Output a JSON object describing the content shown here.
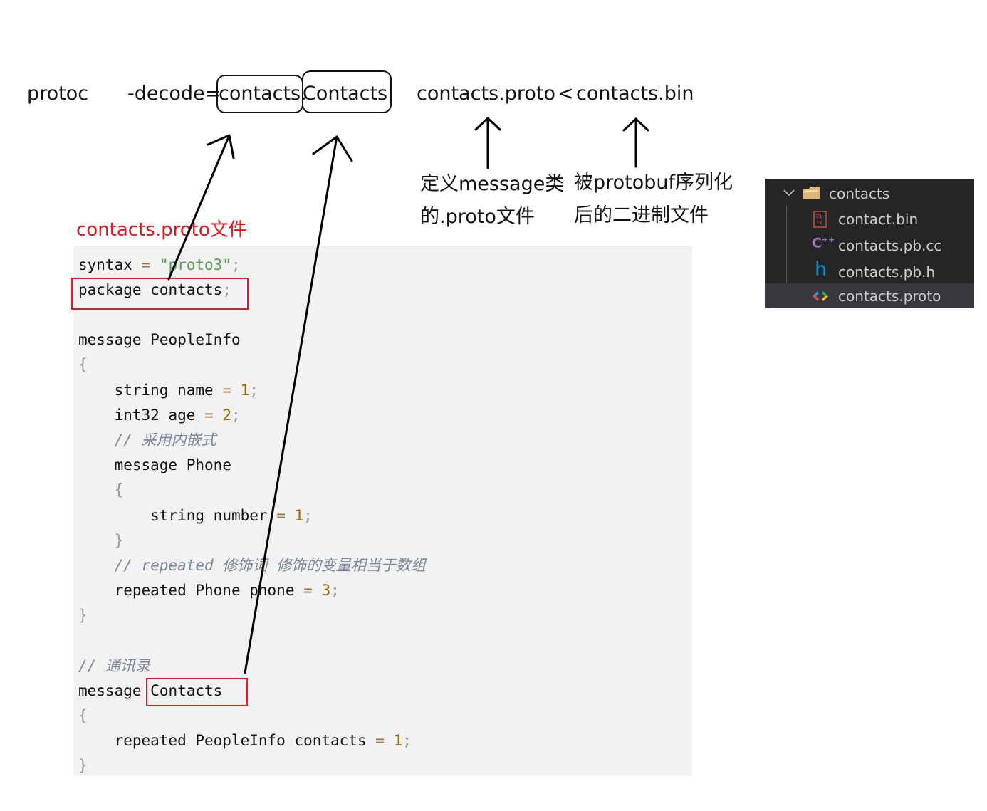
{
  "command": {
    "program": "protoc",
    "flag": "-decode=",
    "package_part": "contacts.",
    "message_part": "Contacts",
    "proto_file": "contacts.proto",
    "redirect": "<",
    "bin_file": "contacts.bin"
  },
  "annotations": {
    "proto_note": [
      "定义message类",
      "的.proto文件"
    ],
    "bin_note": [
      "被protobuf序列化",
      "后的二进制文件"
    ],
    "code_title": "contacts.proto文件"
  },
  "code": {
    "lines": [
      {
        "kind": "syntax",
        "keyword": "syntax",
        "eq": "=",
        "value": "\"proto3\"",
        "semi": ";"
      },
      {
        "kind": "package",
        "keyword": "package",
        "name": "contacts",
        "semi": ";"
      },
      {
        "kind": "message",
        "keyword": "message",
        "name": "PeopleInfo"
      },
      {
        "kind": "brace",
        "text": "{"
      },
      {
        "kind": "field",
        "type": "string",
        "name": "name",
        "eq": "=",
        "num": "1",
        "semi": ";"
      },
      {
        "kind": "field",
        "type": "int32",
        "name": "age",
        "eq": "=",
        "num": "2",
        "semi": ";"
      },
      {
        "kind": "comment",
        "text": "// 采用内嵌式"
      },
      {
        "kind": "message",
        "keyword": "message",
        "name": "Phone"
      },
      {
        "kind": "brace",
        "text": "{"
      },
      {
        "kind": "field",
        "type": "string",
        "name": "number",
        "eq": "=",
        "num": "1",
        "semi": ";"
      },
      {
        "kind": "brace",
        "text": "}"
      },
      {
        "kind": "comment",
        "text": "// repeated 修饰词 修饰的变量相当于数组"
      },
      {
        "kind": "field",
        "type": "repeated Phone",
        "name": "phone",
        "eq": "=",
        "num": "3",
        "semi": ";"
      },
      {
        "kind": "brace",
        "text": "}"
      },
      {
        "kind": "comment",
        "text": "// 通讯录"
      },
      {
        "kind": "message",
        "keyword": "message",
        "name": "Contacts"
      },
      {
        "kind": "brace",
        "text": "{"
      },
      {
        "kind": "field",
        "type": "repeated PeopleInfo",
        "name": "contacts",
        "eq": "=",
        "num": "1",
        "semi": ";"
      },
      {
        "kind": "brace",
        "text": "}"
      }
    ]
  },
  "explorer": {
    "folder": "contacts",
    "files": [
      {
        "name": "contact.bin",
        "icon": "binary-file-icon",
        "color": "#c74c4c"
      },
      {
        "name": "contacts.pb.cc",
        "icon": "cpp-file-icon",
        "color": "#a074c4"
      },
      {
        "name": "contacts.pb.h",
        "icon": "header-file-icon",
        "color": "#0e88c9"
      },
      {
        "name": "contacts.proto",
        "icon": "proto-file-icon",
        "color": "#4285f4",
        "selected": true
      }
    ]
  },
  "colors": {
    "highlight_red": "#e31b23",
    "title_red": "#e8141c",
    "code_bg": "#f2f2f2",
    "explorer_bg": "#252526",
    "explorer_selected": "#37373d"
  }
}
